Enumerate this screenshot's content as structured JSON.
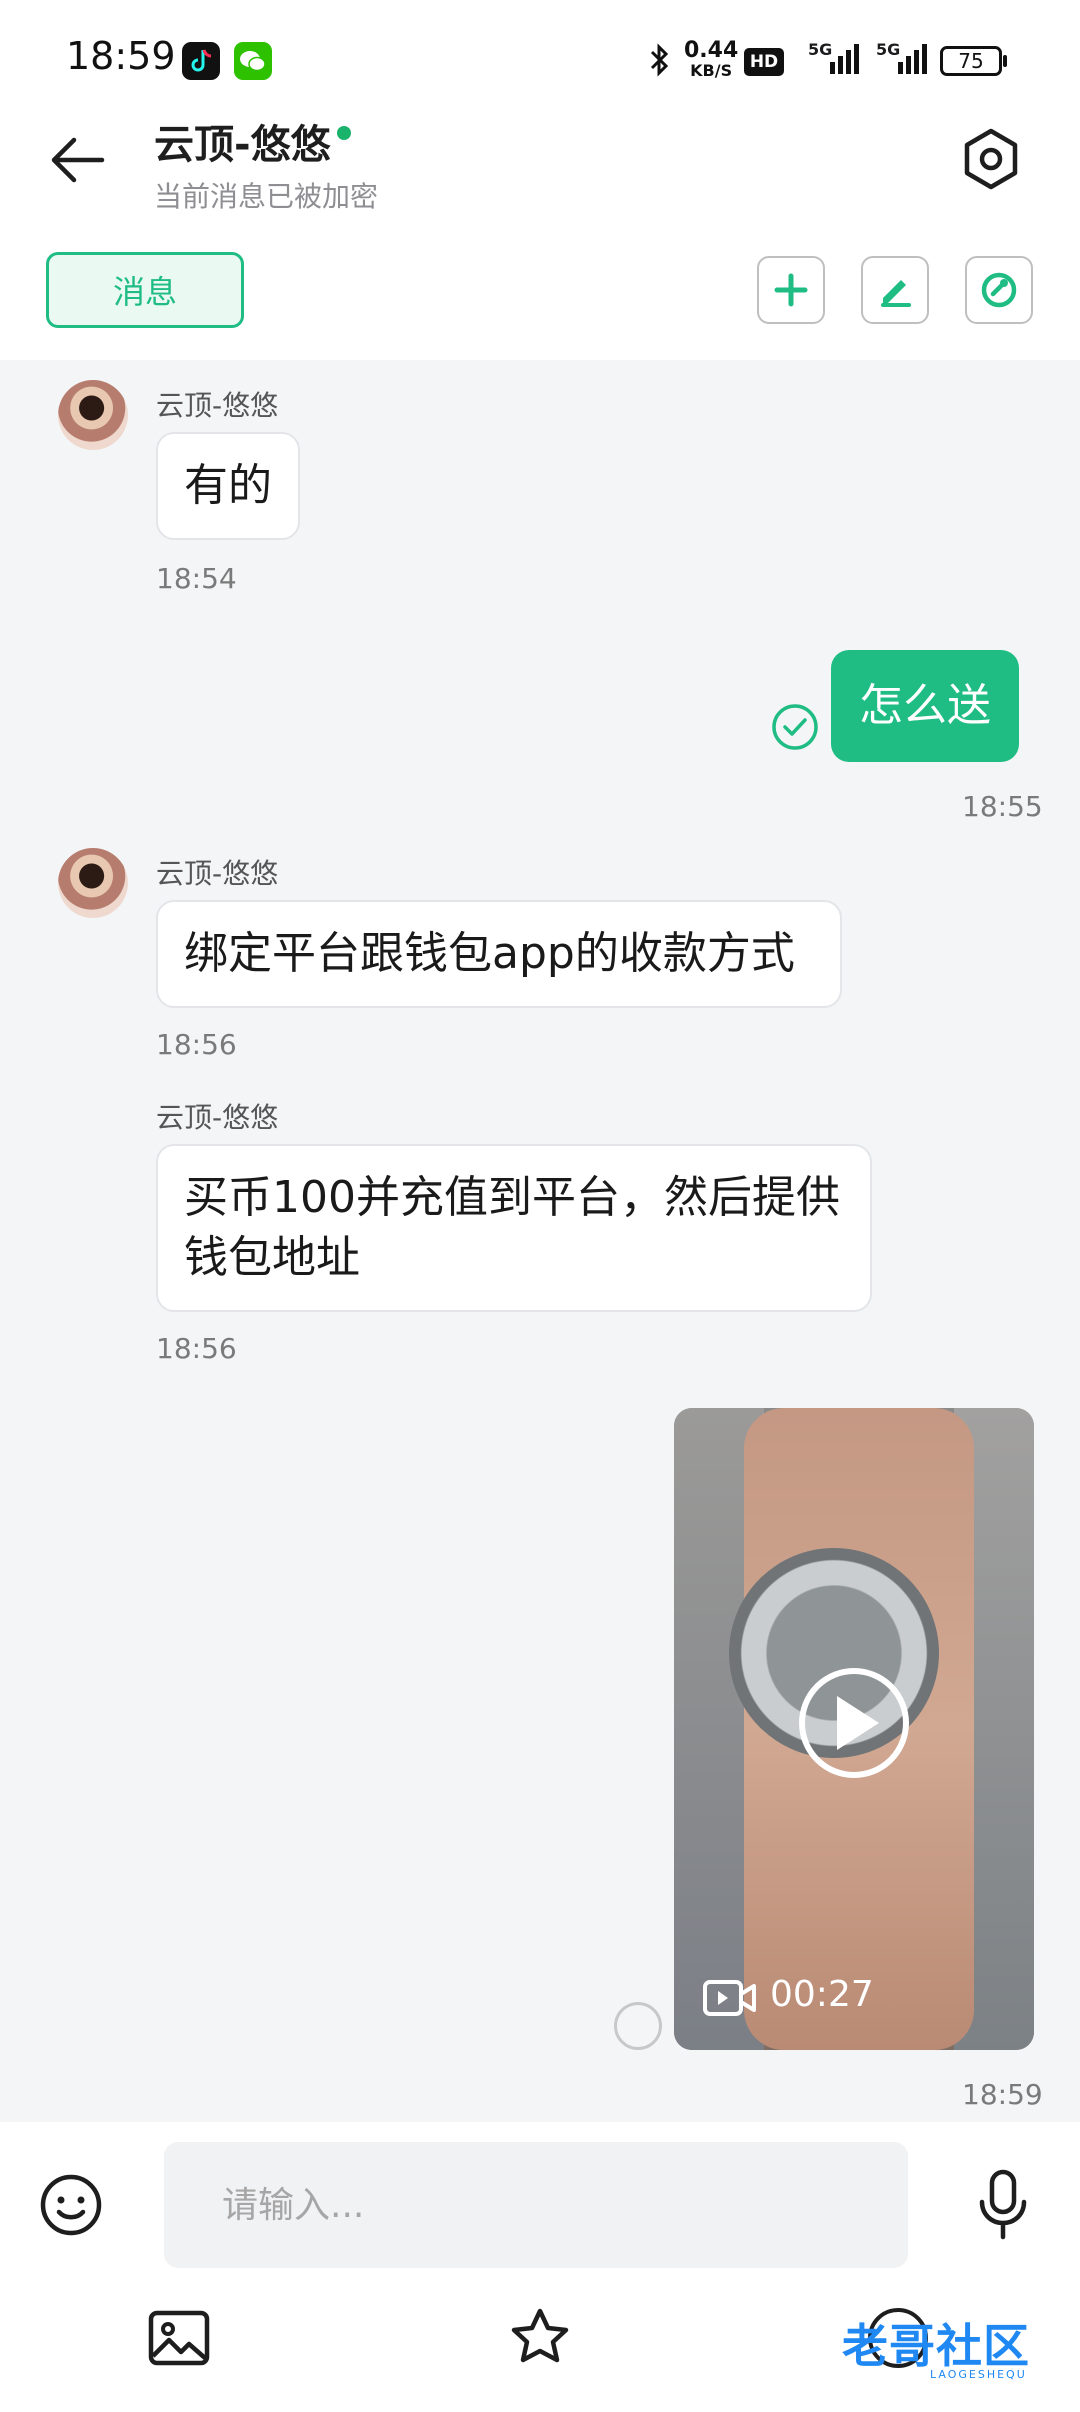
{
  "status_bar": {
    "time": "18:59",
    "net_speed_value": "0.44",
    "net_speed_unit": "KB/S",
    "hd_label": "HD",
    "sim1": "5G",
    "sim2": "5G",
    "battery": "75",
    "apps": [
      "tiktok-icon",
      "wechat-icon"
    ]
  },
  "header": {
    "title": "云顶-悠悠",
    "subtitle": "当前消息已被加密",
    "online": true
  },
  "tabs": {
    "active_label": "消息"
  },
  "messages": [
    {
      "direction": "in",
      "sender": "云顶-悠悠",
      "text": "有的",
      "time": "18:54"
    },
    {
      "direction": "out",
      "text": "怎么送",
      "time": "18:55",
      "status": "read"
    },
    {
      "direction": "in",
      "sender": "云顶-悠悠",
      "text": "绑定平台跟钱包app的收款方式",
      "time": "18:56"
    },
    {
      "direction": "in",
      "sender": "云顶-悠悠",
      "text": "买币100并充值到平台，然后提供钱包地址",
      "time": "18:56"
    },
    {
      "direction": "out",
      "type": "video",
      "duration": "00:27",
      "time": "18:59",
      "status": "sending"
    }
  ],
  "input": {
    "placeholder": "请输入..."
  },
  "watermark": {
    "text": "老哥社区",
    "sub": "LAOGESHEQU"
  },
  "colors": {
    "accent": "#1fbd84",
    "chat_bg": "#f4f5f7",
    "online": "#19b36b"
  }
}
